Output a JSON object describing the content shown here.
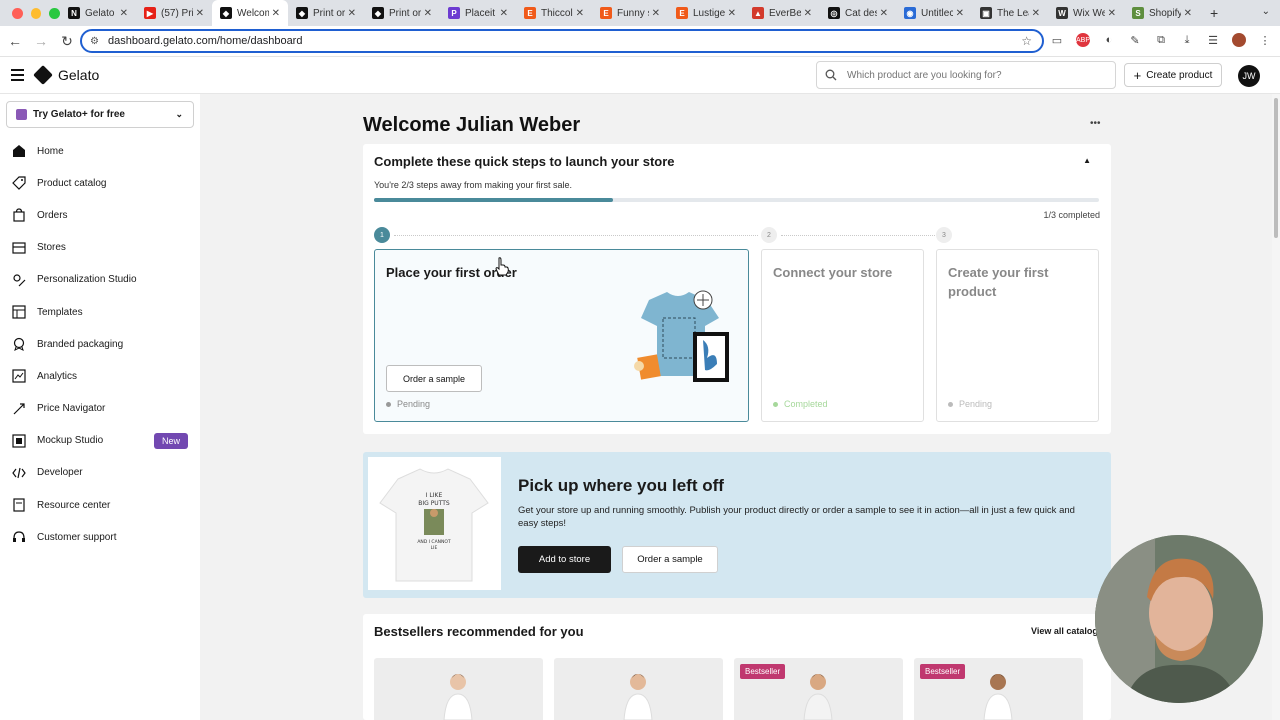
{
  "browser": {
    "tabs": [
      {
        "title": "Gelato",
        "color": "#111111",
        "glyph": "N"
      },
      {
        "title": "(57) Pri",
        "color": "#e62117",
        "glyph": "▶"
      },
      {
        "title": "Welcom",
        "color": "#111111",
        "glyph": "◆",
        "active": true
      },
      {
        "title": "Print or",
        "color": "#111111",
        "glyph": "◆"
      },
      {
        "title": "Print or",
        "color": "#111111",
        "glyph": "◆"
      },
      {
        "title": "Placeit",
        "color": "#6c3bd1",
        "glyph": "P"
      },
      {
        "title": "Thiccol",
        "color": "#f05a1a",
        "glyph": "E"
      },
      {
        "title": "Funny s",
        "color": "#f05a1a",
        "glyph": "E"
      },
      {
        "title": "Lustige",
        "color": "#f05a1a",
        "glyph": "E"
      },
      {
        "title": "EverBe",
        "color": "#d33a2c",
        "glyph": "▲"
      },
      {
        "title": "Cat des",
        "color": "#111111",
        "glyph": "◎"
      },
      {
        "title": "Untitlec",
        "color": "#2a6bd6",
        "glyph": "◉"
      },
      {
        "title": "The Lea",
        "color": "#333333",
        "glyph": "▣"
      },
      {
        "title": "Wix We",
        "color": "#333333",
        "glyph": "W"
      },
      {
        "title": "Shopify",
        "color": "#5e8e3e",
        "glyph": "S"
      }
    ],
    "new_tab": "+",
    "url": "dashboard.gelato.com/home/dashboard"
  },
  "header": {
    "brand": "Gelato",
    "search_placeholder": "Which product are you looking for?",
    "create_label": "Create product",
    "avatar_initials": "JW"
  },
  "sidebar": {
    "try_label": "Try Gelato+ for free",
    "items": [
      {
        "label": "Home",
        "icon": "home-icon"
      },
      {
        "label": "Product catalog",
        "icon": "tag-icon"
      },
      {
        "label": "Orders",
        "icon": "bag-icon"
      },
      {
        "label": "Stores",
        "icon": "store-icon"
      },
      {
        "label": "Personalization Studio",
        "icon": "personalization-icon"
      },
      {
        "label": "Templates",
        "icon": "templates-icon"
      },
      {
        "label": "Branded packaging",
        "icon": "badge-icon"
      },
      {
        "label": "Analytics",
        "icon": "analytics-icon"
      },
      {
        "label": "Price Navigator",
        "icon": "price-icon"
      },
      {
        "label": "Mockup Studio",
        "icon": "mockup-icon",
        "badge": "New"
      },
      {
        "label": "Developer",
        "icon": "code-icon"
      },
      {
        "label": "Resource center",
        "icon": "resource-icon"
      },
      {
        "label": "Customer support",
        "icon": "headset-icon"
      }
    ]
  },
  "main": {
    "welcome": "Welcome Julian Weber",
    "steps": {
      "title": "Complete these quick steps to launch your store",
      "subtitle": "You're 2/3 steps away from making your first sale.",
      "progress": 0.33,
      "completed_text": "1/3 completed",
      "numbers": [
        "1",
        "2",
        "3"
      ],
      "cards": [
        {
          "title": "Place your first order",
          "status": "Pending",
          "button": "Order a sample"
        },
        {
          "title": "Connect your store",
          "status": "Completed"
        },
        {
          "title": "Create your first product",
          "status": "Pending"
        }
      ]
    },
    "pickup": {
      "title": "Pick up where you left off",
      "text": "Get your store up and running smoothly. Publish your product directly or order a sample to see it in action—all in just a few quick and easy steps!",
      "primary": "Add to store",
      "secondary": "Order a sample",
      "shirt_text": "I LIKE BIG PUTTS AND I CANNOT LIE"
    },
    "bestsellers": {
      "title": "Bestsellers recommended for you",
      "view_all": "View all catalog",
      "badges": [
        "",
        "",
        "Bestseller",
        "Bestseller"
      ]
    }
  },
  "colors": {
    "accent": "#4a8a9a",
    "progress_track": "#e4e8ec",
    "pickup_bg": "#d3e7f1",
    "badge_new": "#7248b1",
    "badge_bestseller": "#c0386f"
  }
}
